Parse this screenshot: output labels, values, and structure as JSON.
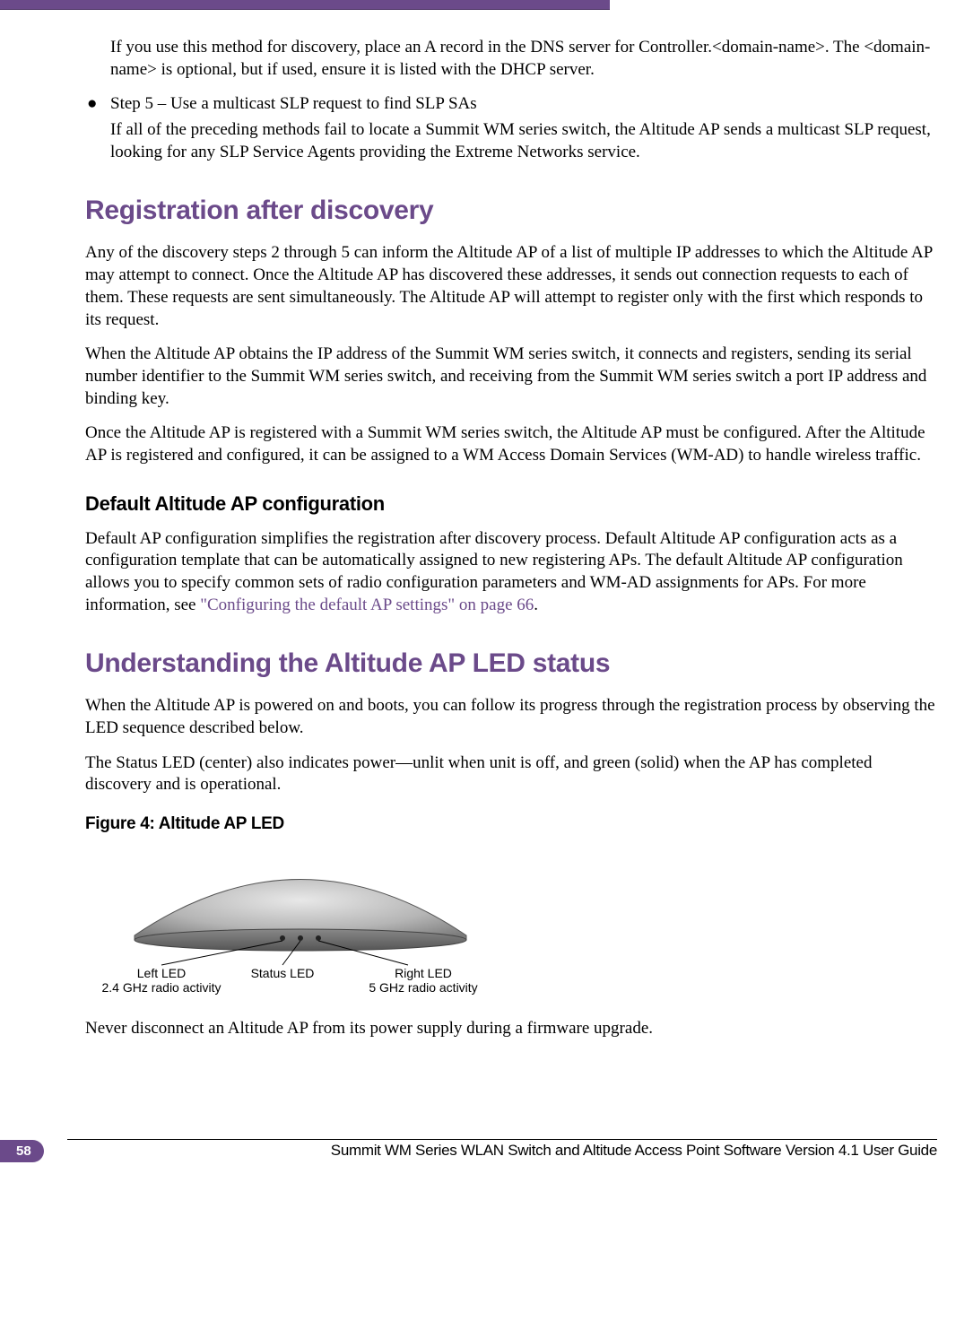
{
  "intro_para": "If you use this method for discovery, place an A record in the DNS server for Controller.<domain-name>. The <domain-name> is optional, but if used, ensure it is listed with the DHCP server.",
  "bullet_step5_title": "Step 5 – Use a multicast SLP request to find SLP SAs",
  "bullet_step5_body": "If all of the preceding methods fail to locate a Summit WM series switch, the Altitude AP sends a multicast SLP request, looking for any SLP Service Agents providing the Extreme Networks service.",
  "heading_registration": "Registration after discovery",
  "reg_para1": "Any of the discovery steps 2 through 5 can inform the Altitude AP of a list of multiple IP addresses to which the Altitude AP may attempt to connect. Once the Altitude AP has discovered these addresses, it sends out connection requests to each of them. These requests are sent simultaneously. The Altitude AP will attempt to register only with the first which responds to its request.",
  "reg_para2": "When the Altitude AP obtains the IP address of the Summit WM series switch, it connects and registers, sending its serial number identifier to the Summit WM series switch, and receiving from the Summit WM series switch a port IP address and binding key.",
  "reg_para3": "Once the Altitude AP is registered with a Summit WM series switch, the Altitude AP must be configured. After the Altitude AP is registered and configured, it can be assigned to a WM Access Domain Services (WM-AD) to handle wireless traffic.",
  "subheading_default": "Default Altitude AP configuration",
  "default_para_pre": "Default AP configuration simplifies the registration after discovery process. Default Altitude AP configuration acts as a configuration template that can be automatically assigned to new registering APs. The default Altitude AP configuration allows you to specify common sets of radio configuration parameters and WM-AD assignments for APs. For more information, see ",
  "default_para_link": "\"Configuring the default AP settings\" on page 66",
  "default_para_post": ".",
  "heading_led": "Understanding the Altitude AP LED status",
  "led_para1": "When the Altitude AP is powered on and boots, you can follow its progress through the registration process by observing the LED sequence described below.",
  "led_para2": "The Status LED (center) also indicates power—unlit when unit is off, and green (solid) when the AP has completed discovery and is operational.",
  "figure_caption": "Figure 4:  Altitude AP LED",
  "figure_labels": {
    "left_title": "Left LED",
    "left_sub": "2.4 GHz radio activity",
    "center_title": "Status LED",
    "right_title": "Right LED",
    "right_sub": "5 GHz radio activity"
  },
  "warning_para": "Never disconnect an Altitude AP from its power supply during a firmware upgrade.",
  "footer": {
    "page_number": "58",
    "doc_title": "Summit WM Series WLAN Switch and Altitude Access Point Software Version 4.1 User Guide"
  }
}
